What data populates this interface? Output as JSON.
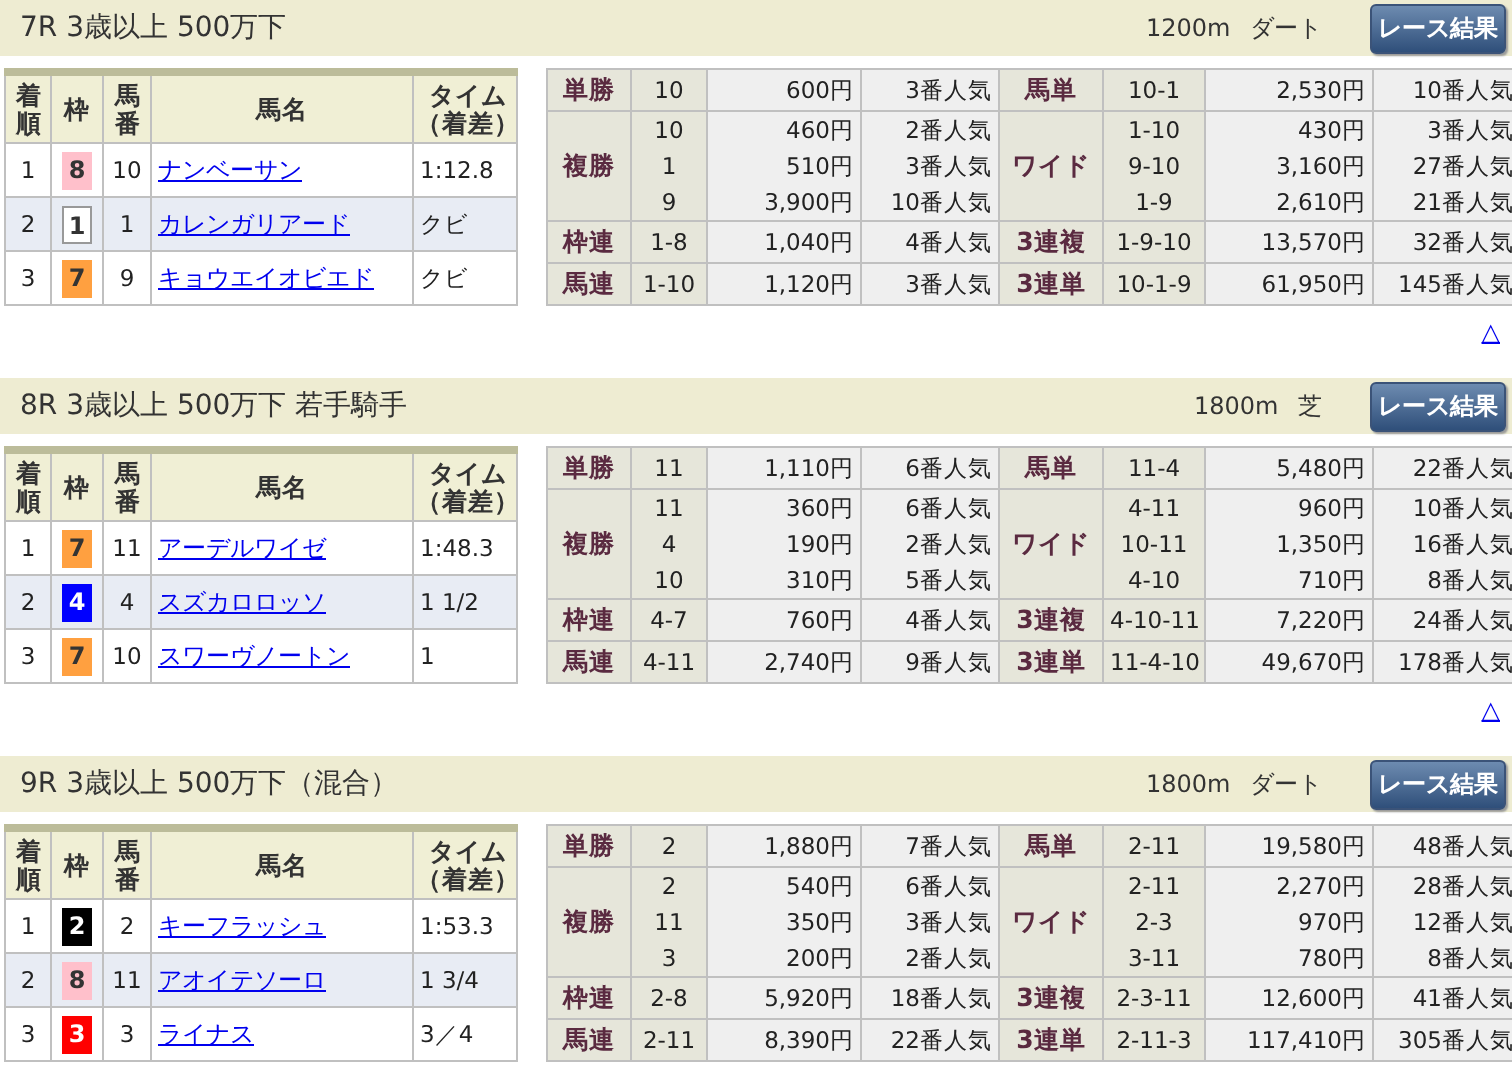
{
  "races": [
    {
      "title": "7R 3歳以上 500万下",
      "distance": "1200m",
      "track": "ダート",
      "button": "レース結果",
      "top_link": "△",
      "columns": [
        "着順",
        "枠",
        "馬番",
        "馬名",
        "タイム（着差）"
      ],
      "results": [
        {
          "place": "1",
          "frame": "8",
          "color": "#ffc0cb",
          "number": "10",
          "name": "ナンベーサン",
          "time": "1:12.8"
        },
        {
          "place": "2",
          "frame": "1",
          "color": "#ffffff",
          "number": "1",
          "name": "カレンガリアード",
          "time": "クビ"
        },
        {
          "place": "3",
          "frame": "7",
          "color": "#ffa040",
          "number": "9",
          "name": "キョウエイオビエド",
          "time": "クビ"
        }
      ],
      "payouts": [
        {
          "left": {
            "bet": "単勝",
            "entries": [
              {
                "combo": "10",
                "payout": "600円",
                "popularity": "3番人気"
              }
            ]
          },
          "right": {
            "bet": "馬単",
            "entries": [
              {
                "combo": "10-1",
                "payout": "2,530円",
                "popularity": "10番人気"
              }
            ]
          }
        },
        {
          "left": {
            "bet": "複勝",
            "entries": [
              {
                "combo": "10",
                "payout": "460円",
                "popularity": "2番人気"
              },
              {
                "combo": "1",
                "payout": "510円",
                "popularity": "3番人気"
              },
              {
                "combo": "9",
                "payout": "3,900円",
                "popularity": "10番人気"
              }
            ]
          },
          "right": {
            "bet": "ワイド",
            "entries": [
              {
                "combo": "1-10",
                "payout": "430円",
                "popularity": "3番人気"
              },
              {
                "combo": "9-10",
                "payout": "3,160円",
                "popularity": "27番人気"
              },
              {
                "combo": "1-9",
                "payout": "2,610円",
                "popularity": "21番人気"
              }
            ]
          }
        },
        {
          "left": {
            "bet": "枠連",
            "entries": [
              {
                "combo": "1-8",
                "payout": "1,040円",
                "popularity": "4番人気"
              }
            ]
          },
          "right": {
            "bet": "3連複",
            "entries": [
              {
                "combo": "1-9-10",
                "payout": "13,570円",
                "popularity": "32番人気"
              }
            ]
          }
        },
        {
          "left": {
            "bet": "馬連",
            "entries": [
              {
                "combo": "1-10",
                "payout": "1,120円",
                "popularity": "3番人気"
              }
            ]
          },
          "right": {
            "bet": "3連単",
            "entries": [
              {
                "combo": "10-1-9",
                "payout": "61,950円",
                "popularity": "145番人気"
              }
            ]
          }
        }
      ]
    },
    {
      "title": "8R 3歳以上 500万下 若手騎手",
      "distance": "1800m",
      "track": "芝",
      "button": "レース結果",
      "top_link": "△",
      "columns": [
        "着順",
        "枠",
        "馬番",
        "馬名",
        "タイム（着差）"
      ],
      "results": [
        {
          "place": "1",
          "frame": "7",
          "color": "#ffa040",
          "number": "11",
          "name": "アーデルワイゼ",
          "time": "1:48.3"
        },
        {
          "place": "2",
          "frame": "4",
          "color": "#0000ff",
          "number": "4",
          "name": "スズカロロッソ",
          "time": "1 1/2"
        },
        {
          "place": "3",
          "frame": "7",
          "color": "#ffa040",
          "number": "10",
          "name": "スワーヴノートン",
          "time": "1"
        }
      ],
      "payouts": [
        {
          "left": {
            "bet": "単勝",
            "entries": [
              {
                "combo": "11",
                "payout": "1,110円",
                "popularity": "6番人気"
              }
            ]
          },
          "right": {
            "bet": "馬単",
            "entries": [
              {
                "combo": "11-4",
                "payout": "5,480円",
                "popularity": "22番人気"
              }
            ]
          }
        },
        {
          "left": {
            "bet": "複勝",
            "entries": [
              {
                "combo": "11",
                "payout": "360円",
                "popularity": "6番人気"
              },
              {
                "combo": "4",
                "payout": "190円",
                "popularity": "2番人気"
              },
              {
                "combo": "10",
                "payout": "310円",
                "popularity": "5番人気"
              }
            ]
          },
          "right": {
            "bet": "ワイド",
            "entries": [
              {
                "combo": "4-11",
                "payout": "960円",
                "popularity": "10番人気"
              },
              {
                "combo": "10-11",
                "payout": "1,350円",
                "popularity": "16番人気"
              },
              {
                "combo": "4-10",
                "payout": "710円",
                "popularity": "8番人気"
              }
            ]
          }
        },
        {
          "left": {
            "bet": "枠連",
            "entries": [
              {
                "combo": "4-7",
                "payout": "760円",
                "popularity": "4番人気"
              }
            ]
          },
          "right": {
            "bet": "3連複",
            "entries": [
              {
                "combo": "4-10-11",
                "payout": "7,220円",
                "popularity": "24番人気"
              }
            ]
          }
        },
        {
          "left": {
            "bet": "馬連",
            "entries": [
              {
                "combo": "4-11",
                "payout": "2,740円",
                "popularity": "9番人気"
              }
            ]
          },
          "right": {
            "bet": "3連単",
            "entries": [
              {
                "combo": "11-4-10",
                "payout": "49,670円",
                "popularity": "178番人気"
              }
            ]
          }
        }
      ]
    },
    {
      "title": "9R 3歳以上 500万下（混合）",
      "distance": "1800m",
      "track": "ダート",
      "button": "レース結果",
      "columns": [
        "着順",
        "枠",
        "馬番",
        "馬名",
        "タイム（着差）"
      ],
      "results": [
        {
          "place": "1",
          "frame": "2",
          "color": "#000000",
          "number": "2",
          "name": "キーフラッシュ",
          "time": "1:53.3"
        },
        {
          "place": "2",
          "frame": "8",
          "color": "#ffc0cb",
          "number": "11",
          "name": "アオイテソーロ",
          "time": "1 3/4"
        },
        {
          "place": "3",
          "frame": "3",
          "color": "#ff0000",
          "number": "3",
          "name": "ライナス",
          "time": "3／4"
        }
      ],
      "payouts": [
        {
          "left": {
            "bet": "単勝",
            "entries": [
              {
                "combo": "2",
                "payout": "1,880円",
                "popularity": "7番人気"
              }
            ]
          },
          "right": {
            "bet": "馬単",
            "entries": [
              {
                "combo": "2-11",
                "payout": "19,580円",
                "popularity": "48番人気"
              }
            ]
          }
        },
        {
          "left": {
            "bet": "複勝",
            "entries": [
              {
                "combo": "2",
                "payout": "540円",
                "popularity": "6番人気"
              },
              {
                "combo": "11",
                "payout": "350円",
                "popularity": "3番人気"
              },
              {
                "combo": "3",
                "payout": "200円",
                "popularity": "2番人気"
              }
            ]
          },
          "right": {
            "bet": "ワイド",
            "entries": [
              {
                "combo": "2-11",
                "payout": "2,270円",
                "popularity": "28番人気"
              },
              {
                "combo": "2-3",
                "payout": "970円",
                "popularity": "12番人気"
              },
              {
                "combo": "3-11",
                "payout": "780円",
                "popularity": "8番人気"
              }
            ]
          }
        },
        {
          "left": {
            "bet": "枠連",
            "entries": [
              {
                "combo": "2-8",
                "payout": "5,920円",
                "popularity": "18番人気"
              }
            ]
          },
          "right": {
            "bet": "3連複",
            "entries": [
              {
                "combo": "2-3-11",
                "payout": "12,600円",
                "popularity": "41番人気"
              }
            ]
          }
        },
        {
          "left": {
            "bet": "馬連",
            "entries": [
              {
                "combo": "2-11",
                "payout": "8,390円",
                "popularity": "22番人気"
              }
            ]
          },
          "right": {
            "bet": "3連単",
            "entries": [
              {
                "combo": "2-11-3",
                "payout": "117,410円",
                "popularity": "305番人気"
              }
            ]
          }
        }
      ]
    }
  ]
}
